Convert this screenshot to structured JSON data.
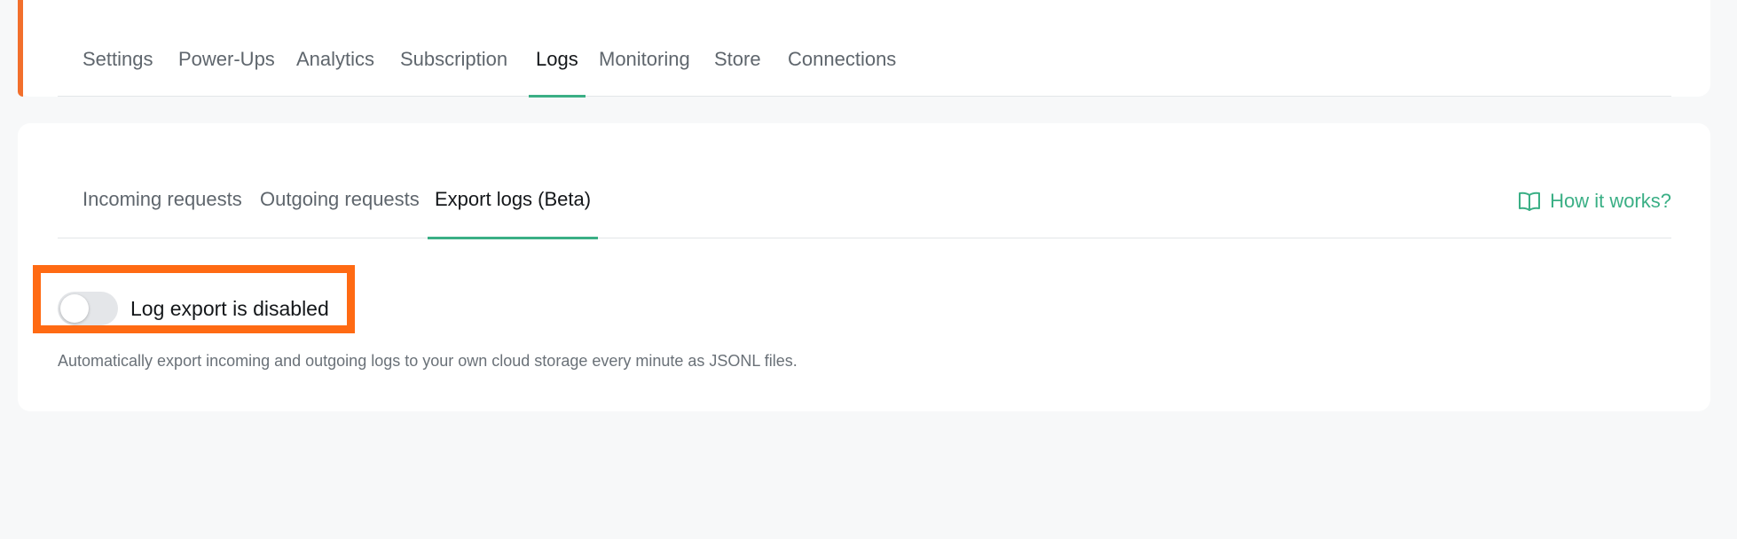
{
  "main_tabs": [
    {
      "label": "Settings",
      "active": false
    },
    {
      "label": "Power-Ups",
      "active": false
    },
    {
      "label": "Analytics",
      "active": false
    },
    {
      "label": "Subscription",
      "active": false
    },
    {
      "label": "Logs",
      "active": true
    },
    {
      "label": "Monitoring",
      "active": false
    },
    {
      "label": "Store",
      "active": false
    },
    {
      "label": "Connections",
      "active": false
    }
  ],
  "sub_tabs": [
    {
      "label": "Incoming requests",
      "active": false
    },
    {
      "label": "Outgoing requests",
      "active": false
    },
    {
      "label": "Export logs (Beta)",
      "active": true
    }
  ],
  "help_link": {
    "label": "How it works?",
    "icon": "book-icon"
  },
  "log_export": {
    "enabled": false,
    "label": "Log export is disabled",
    "description": "Automatically export incoming and outgoing logs to your own cloud storage every minute as JSONL files."
  },
  "colors": {
    "accent": "#3aaf85",
    "sidebar_accent": "#f26f2c",
    "highlight": "#ff6a13",
    "background": "#f7f8f9"
  }
}
